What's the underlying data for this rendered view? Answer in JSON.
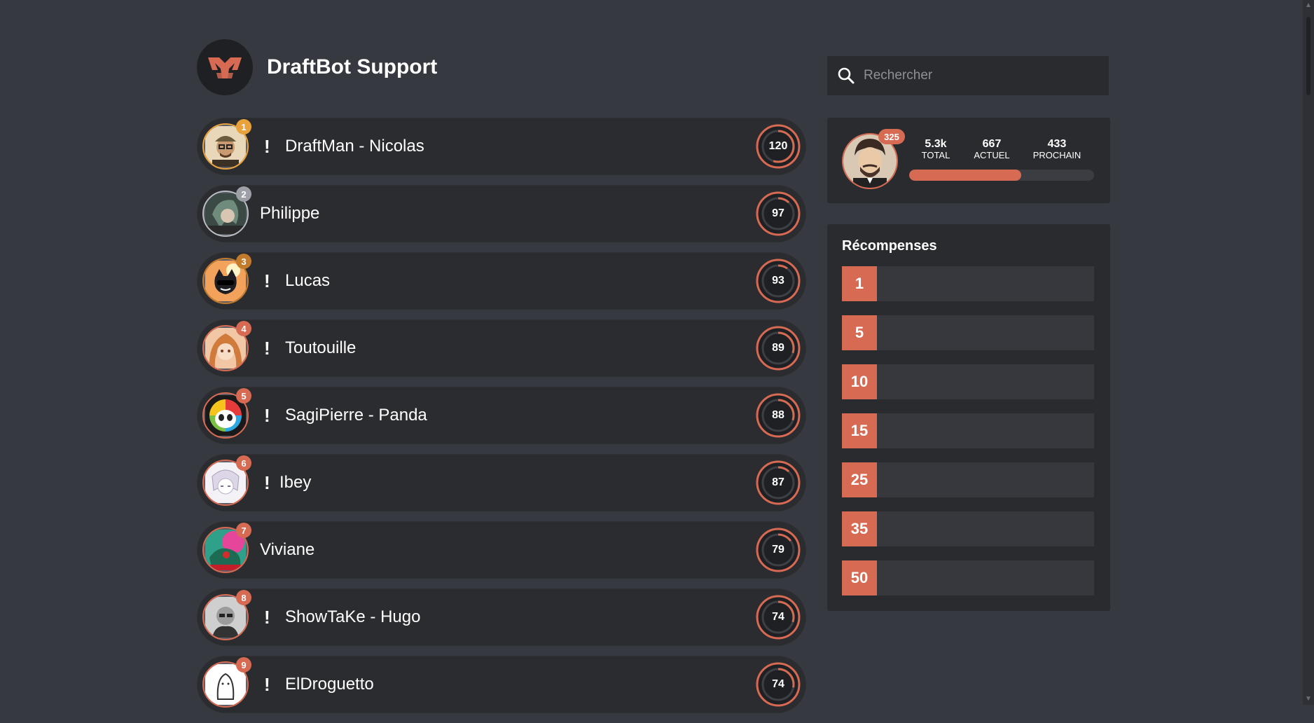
{
  "server": {
    "name": "DraftBot Support",
    "logo_icon": "draftbot-logo-icon"
  },
  "search": {
    "placeholder": "Rechercher"
  },
  "leaderboard": [
    {
      "rank": "1",
      "name": "DraftMan - Nicolas",
      "bang": "!",
      "level": "120",
      "progress": 0.55
    },
    {
      "rank": "2",
      "name": "Philippe",
      "bang": "",
      "level": "97",
      "progress": 0.12
    },
    {
      "rank": "3",
      "name": "Lucas",
      "bang": "!",
      "level": "93",
      "progress": 0.1
    },
    {
      "rank": "4",
      "name": "Toutouille",
      "bang": "!",
      "level": "89",
      "progress": 0.3
    },
    {
      "rank": "5",
      "name": "SagiPierre - Panda",
      "bang": "!",
      "level": "88",
      "progress": 0.3
    },
    {
      "rank": "6",
      "name": "Ibey",
      "bang": "!",
      "level": "87",
      "progress": 0.12
    },
    {
      "rank": "7",
      "name": "Viviane",
      "bang": "",
      "level": "79",
      "progress": 0.15
    },
    {
      "rank": "8",
      "name": "ShowTaKe - Hugo",
      "bang": "!",
      "level": "74",
      "progress": 0.3
    },
    {
      "rank": "9",
      "name": "ElDroguetto",
      "bang": "!",
      "level": "74",
      "progress": 0.28
    }
  ],
  "profile": {
    "rank_badge": "325",
    "stats": [
      {
        "value": "5.3k",
        "label": "TOTAL"
      },
      {
        "value": "667",
        "label": "ACTUEL"
      },
      {
        "value": "433",
        "label": "PROCHAIN"
      }
    ],
    "xp_fraction": 0.606
  },
  "rewards": {
    "title": "Récompenses",
    "levels": [
      "1",
      "5",
      "10",
      "15",
      "25",
      "35",
      "50"
    ]
  },
  "colors": {
    "accent": "#d66a52",
    "background": "#36393f",
    "card": "#2a2b2f"
  }
}
